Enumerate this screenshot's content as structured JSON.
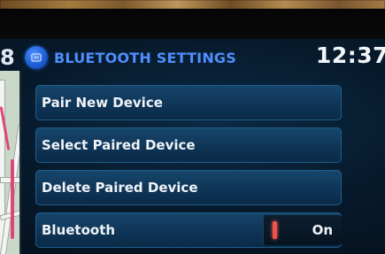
{
  "header": {
    "title": "BLUETOOTH SETTINGS",
    "clock": "12:37",
    "map_digit": "8",
    "icon": "bluetooth-icon"
  },
  "menu": {
    "items": [
      {
        "label": "Pair New Device"
      },
      {
        "label": "Select Paired Device"
      },
      {
        "label": "Delete Paired Device"
      },
      {
        "label": "Bluetooth",
        "toggle_value": "On"
      }
    ]
  },
  "colors": {
    "accent": "#4f8eff",
    "item_bg": "#0f3557",
    "toggle_indicator": "#f0524a"
  }
}
